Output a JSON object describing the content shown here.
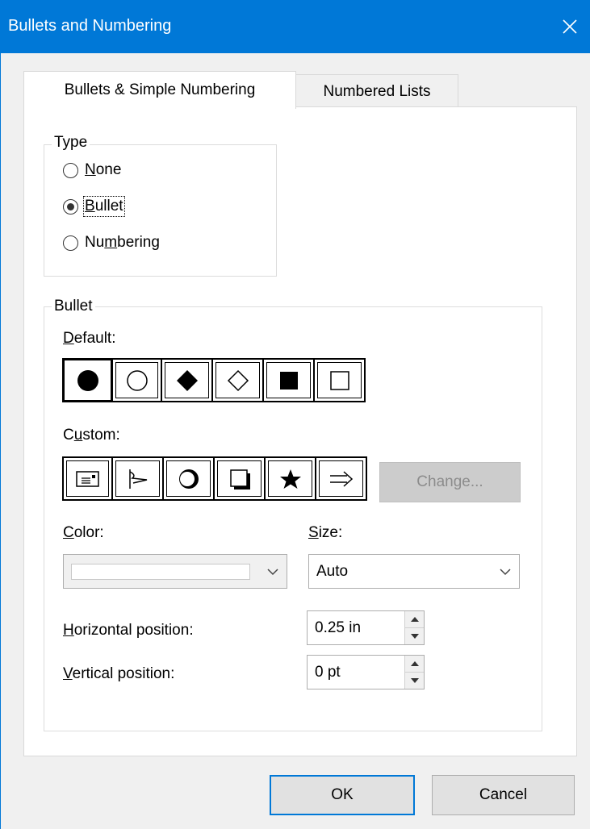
{
  "window": {
    "title": "Bullets and Numbering",
    "close_icon": "close-icon"
  },
  "tabs": [
    {
      "label": "Bullets & Simple Numbering",
      "active": true
    },
    {
      "label": "Numbered Lists",
      "active": false
    }
  ],
  "type_group": {
    "title": "Type",
    "options": [
      {
        "pre": "",
        "key": "N",
        "post": "one",
        "checked": false
      },
      {
        "pre": "",
        "key": "B",
        "post": "ullet",
        "checked": true
      },
      {
        "pre": "Nu",
        "key": "m",
        "post": "bering",
        "checked": false
      }
    ]
  },
  "bullet_group": {
    "title": "Bullet",
    "default_label": {
      "key": "D",
      "post": "efault:"
    },
    "default_bullets": [
      "filled-circle-icon",
      "hollow-circle-icon",
      "filled-diamond-icon",
      "hollow-diamond-icon",
      "filled-square-icon",
      "hollow-square-icon"
    ],
    "default_selected_index": 0,
    "custom_label": {
      "pre": "C",
      "key": "u",
      "post": "stom:"
    },
    "custom_bullets": [
      "document-icon",
      "flag-icon",
      "crescent-circle-icon",
      "shadow-square-icon",
      "star-icon",
      "double-arrow-icon"
    ],
    "change_button": "Change...",
    "color_label": {
      "key": "C",
      "post": "olor:"
    },
    "color_value": "",
    "size_label": {
      "key": "S",
      "post": "ize:"
    },
    "size_value": "Auto",
    "horizontal_label": {
      "key": "H",
      "post": "orizontal position:"
    },
    "horizontal_value": "0.25 in",
    "vertical_label": {
      "key": "V",
      "post": "ertical position:"
    },
    "vertical_value": "0 pt"
  },
  "buttons": {
    "ok": "OK",
    "cancel": "Cancel"
  },
  "colors": {
    "titlebar": "#0078d7",
    "dialog_bg": "#f0f0f0",
    "panel_bg": "#ffffff"
  }
}
